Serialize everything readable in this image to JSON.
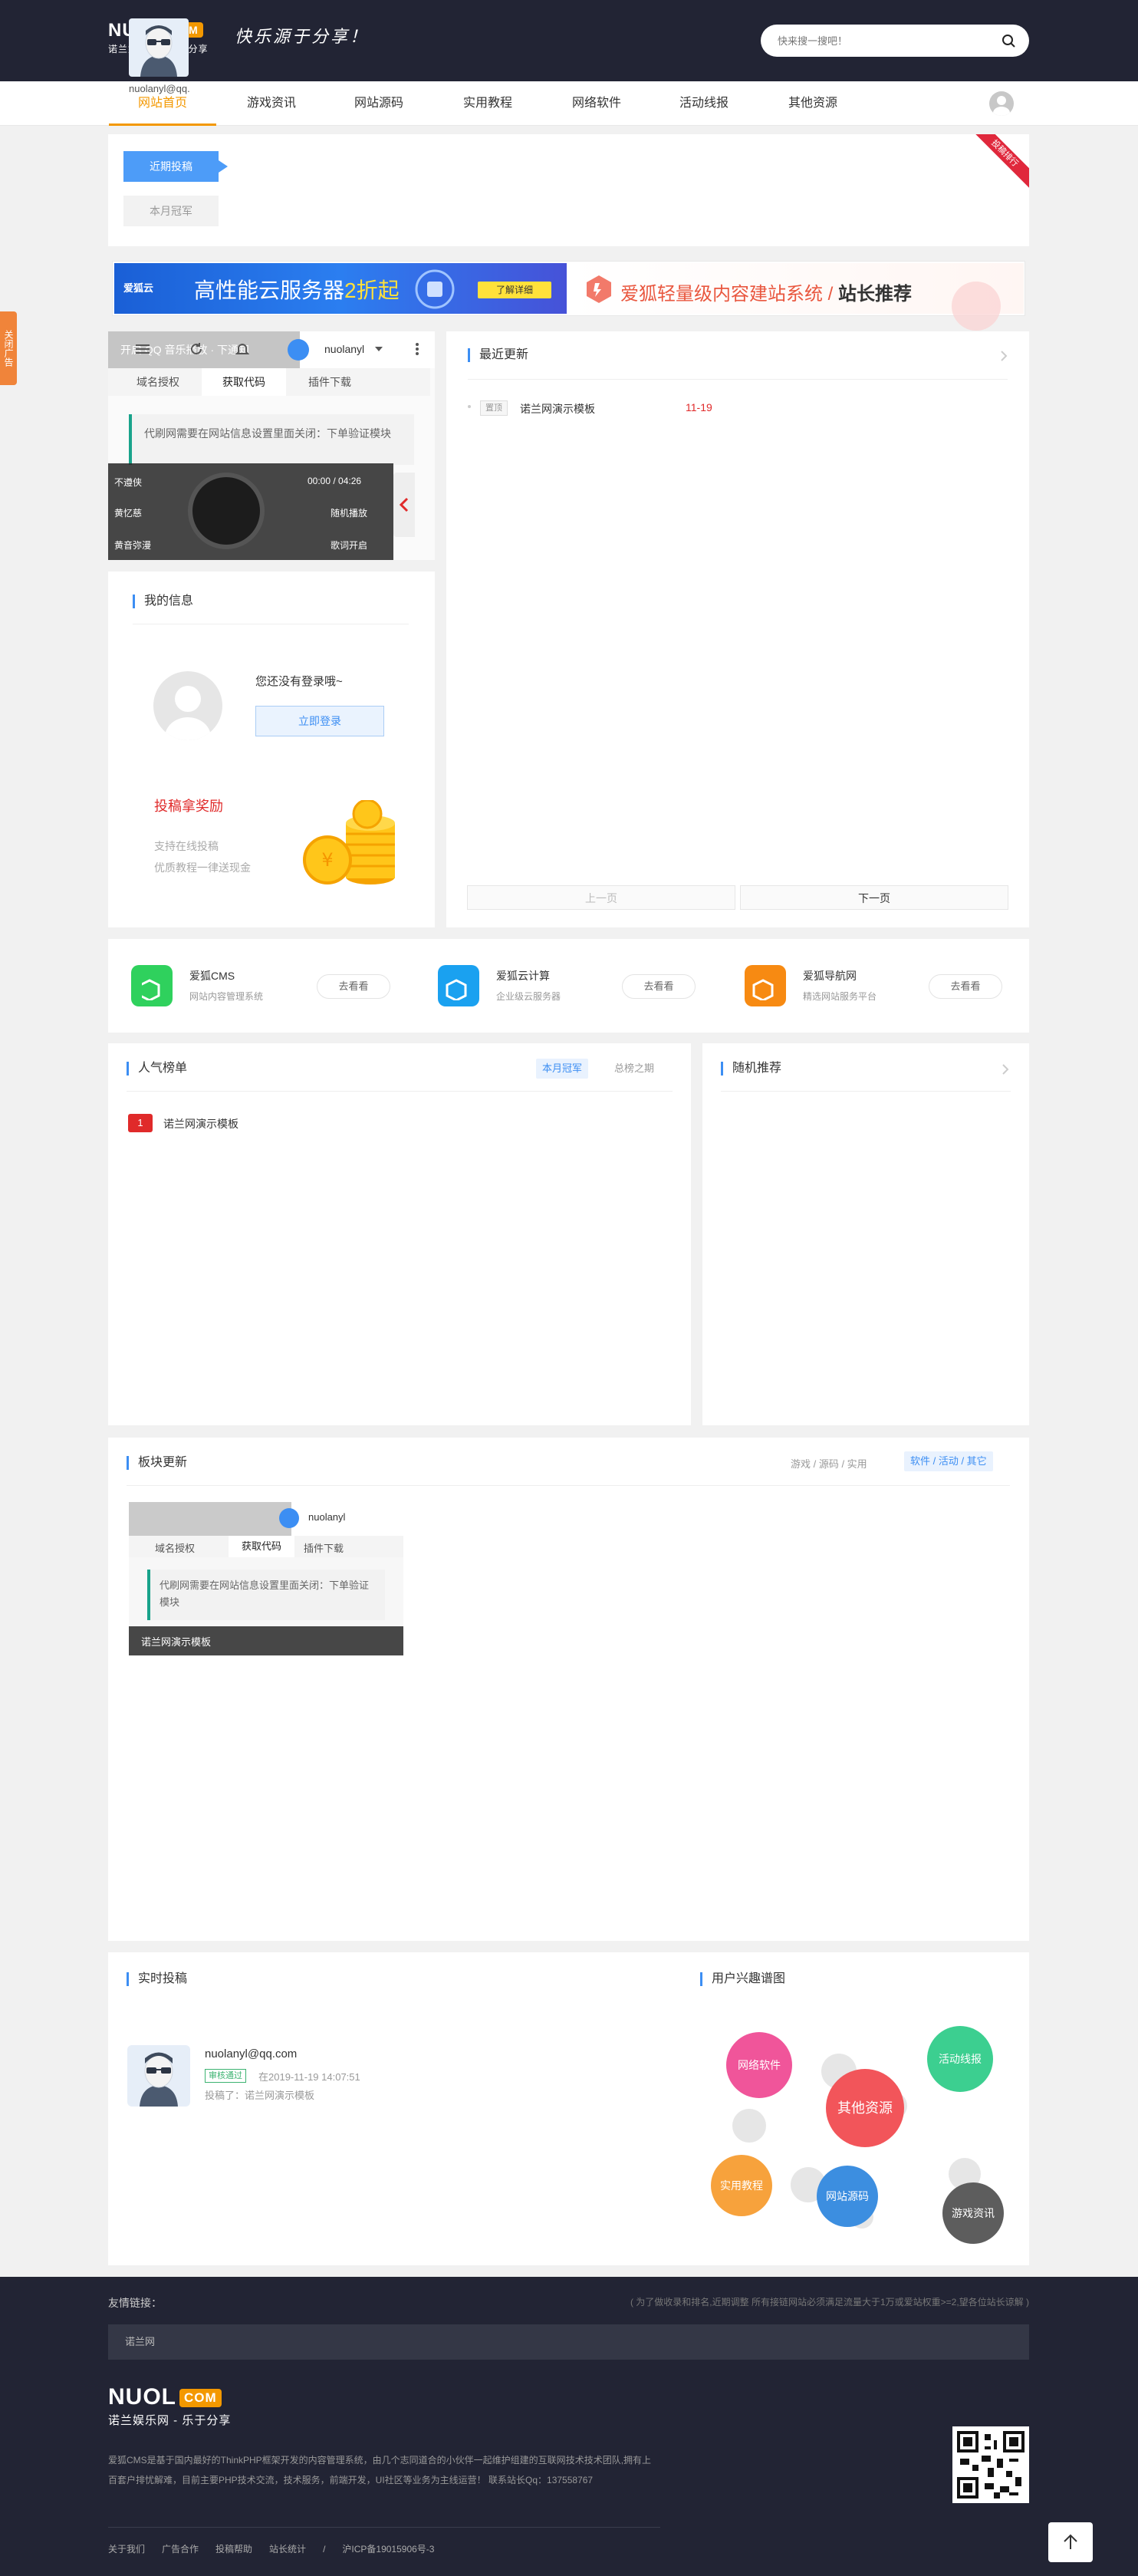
{
  "header": {
    "logo_text": "NUOL",
    "logo_badge": "COM",
    "logo_sub": "诺兰娱乐网 - 乐于分享",
    "slogan": "快乐源于分享！",
    "search_placeholder": "快来搜一搜吧！"
  },
  "nav": {
    "items": [
      "网站首页",
      "游戏资讯",
      "网站源码",
      "实用教程",
      "网络软件",
      "活动线报",
      "其他资源"
    ],
    "active": "网站首页"
  },
  "side_tab": "关闭广告",
  "contributors": {
    "tab_recent": "近期投稿",
    "tab_month": "本月冠军",
    "user_name": "nuolanyl@qq.com",
    "ribbon": "投稿排行"
  },
  "ad": {
    "left_brand": "爱狐云",
    "left_text_a": "高性能云服务器",
    "left_text_b": "2折起",
    "left_button": "了解详细",
    "right_text_a": "爱狐轻量级内容建站系统 / ",
    "right_text_b": "站长推荐"
  },
  "player": {
    "toolbar_text": "开启 QQ 音乐播放 · 下通知",
    "user": "nuolanyl",
    "tabs": [
      "域名授权",
      "获取代码",
      "插件下载"
    ],
    "notice": "代刷网需要在网站信息设置里面关闭：下单验证模块",
    "controls": {
      "stop": "不遵侠",
      "time": "00:00 / 04:26",
      "artist": "黄忆慈",
      "shuffle": "随机播放",
      "quality": "黄音弥漫",
      "lyrics": "歌词开启"
    }
  },
  "my_info": {
    "title": "我的信息",
    "not_logged": "您还没有登录哦~",
    "login_button": "立即登录",
    "reward_title": "投稿拿奖励",
    "reward_line1": "支持在线投稿",
    "reward_line2": "优质教程一律送现金"
  },
  "latest": {
    "title": "最近更新",
    "items": [
      {
        "tag": "置顶",
        "title": "诺兰网演示模板",
        "date": "11-19"
      }
    ],
    "prev": "上一页",
    "next": "下一页"
  },
  "products": [
    {
      "name": "爱狐CMS",
      "desc": "网站内容管理系统",
      "button": "去看看",
      "color": "#2fd15d"
    },
    {
      "name": "爱狐云计算",
      "desc": "企业级云服务器",
      "button": "去看看",
      "color": "#1aa1f0"
    },
    {
      "name": "爱狐导航网",
      "desc": "精选网站服务平台",
      "button": "去看看",
      "color": "#f78a12"
    }
  ],
  "popular": {
    "title": "人气榜单",
    "tab_month": "本月冠军",
    "tab_all": "总榜之期",
    "items": [
      {
        "rank": "1",
        "title": "诺兰网演示模板"
      }
    ]
  },
  "random": {
    "title": "随机推荐"
  },
  "blocks": {
    "title": "板块更新",
    "filter_a": "游戏 / 源码 / 实用",
    "filter_b": "软件 / 活动 / 其它",
    "item_caption": "诺兰网演示模板"
  },
  "realtime": {
    "title": "实时投稿",
    "user": "nuolanyl@qq.com",
    "status": "审核通过",
    "time": "在2019-11-19 14:07:51",
    "action": "投稿了：诺兰网演示模板"
  },
  "interest": {
    "title": "用户兴趣谱图",
    "bubbles": [
      {
        "label": "网络软件",
        "color": "#f0559a"
      },
      {
        "label": "活动线报",
        "color": "#3ccf90"
      },
      {
        "label": "其他资源",
        "color": "#f2555a"
      },
      {
        "label": "实用教程",
        "color": "#f7a23c"
      },
      {
        "label": "网站源码",
        "color": "#3c8ee0"
      },
      {
        "label": "游戏资讯",
        "color": "#5d5d5d"
      }
    ]
  },
  "footer": {
    "friend_label": "友情链接：",
    "friend_note": "( 为了做收录和排名,近期调整 所有接链网站必须满足流量大于1万或爱站权重>=2,望各位站长谅解 )",
    "friend_link": "诺兰网",
    "logo_text": "NUOL",
    "logo_badge": "COM",
    "logo_sub": "诺兰娱乐网 - 乐于分享",
    "desc": "爱狐CMS是基于国内最好的ThinkPHP框架开发的内容管理系统，由几个志同道合的小伙伴一起维护组建的互联网技术技术团队,拥有上百套户排忧解难，目前主要PHP技术交流，技术服务，前端开发，UI社区等业务为主线运营！ 联系站长Qq：137558767",
    "links": [
      "关于我们",
      "广告合作",
      "投稿帮助",
      "站长统计",
      "/",
      "沪ICP备19015906号-3"
    ]
  }
}
